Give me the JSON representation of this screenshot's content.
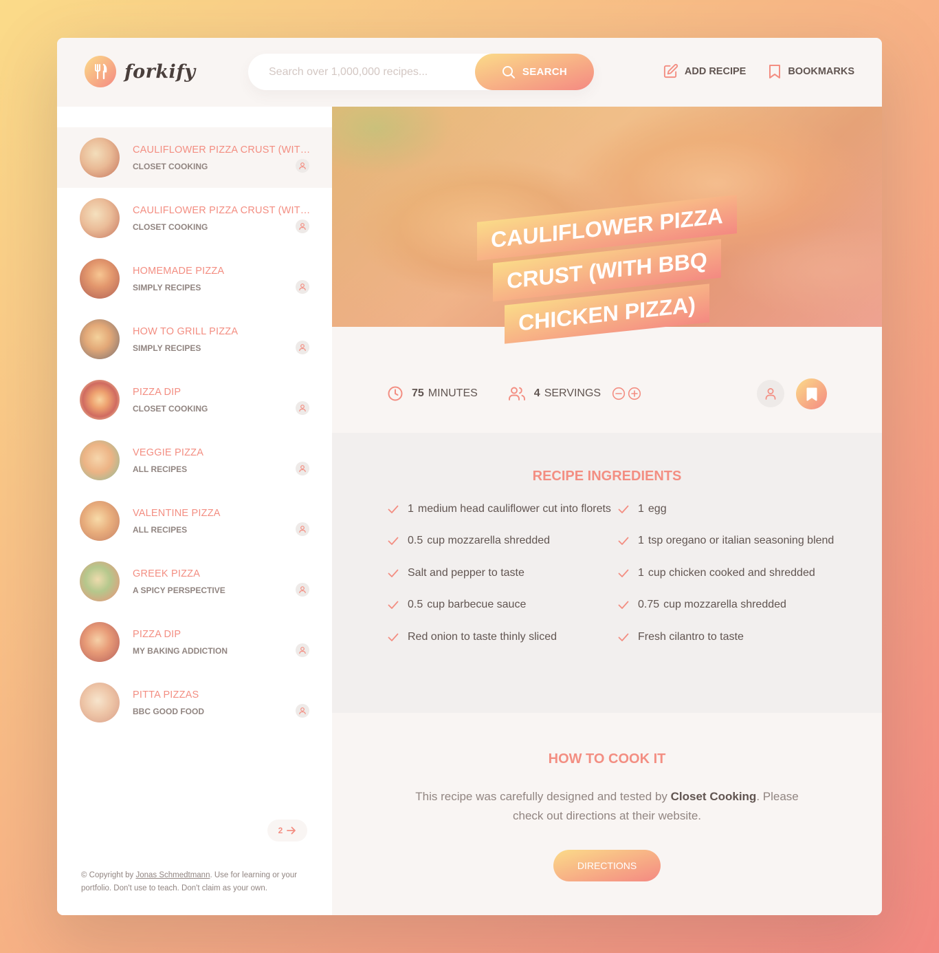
{
  "app": {
    "name": "forkify"
  },
  "search": {
    "placeholder": "Search over 1,000,000 recipes...",
    "button_label": "Search"
  },
  "nav": {
    "add_recipe": "Add recipe",
    "bookmarks": "Bookmarks"
  },
  "results": [
    {
      "title": "CAULIFLOWER PIZZA CRUST (WITH BBQ CHICKEN PIZZA)",
      "publisher": "Closet Cooking",
      "active": true
    },
    {
      "title": "CAULIFLOWER PIZZA CRUST (WITH BBQ CHICKEN PIZZA)",
      "publisher": "Closet Cooking",
      "active": false
    },
    {
      "title": "Homemade Pizza",
      "publisher": "Simply Recipes",
      "active": false
    },
    {
      "title": "How to Grill Pizza",
      "publisher": "Simply Recipes",
      "active": false
    },
    {
      "title": "Pizza Dip",
      "publisher": "Closet Cooking",
      "active": false
    },
    {
      "title": "Veggie Pizza",
      "publisher": "All Recipes",
      "active": false
    },
    {
      "title": "Valentine Pizza",
      "publisher": "All Recipes",
      "active": false
    },
    {
      "title": "Greek Pizza",
      "publisher": "A Spicy Perspective",
      "active": false
    },
    {
      "title": "Pizza Dip",
      "publisher": "My Baking Addiction",
      "active": false
    },
    {
      "title": "Pitta Pizzas",
      "publisher": "BBC Good Food",
      "active": false
    }
  ],
  "pagination": {
    "next_page": "2"
  },
  "copyright": {
    "prefix": "© Copyright by",
    "author": "Jonas Schmedtmann",
    "suffix": ". Use for learning or your portfolio. Don't use to teach. Don't claim as your own."
  },
  "recipe": {
    "title_lines": [
      "Cauliflower Pizza",
      "Crust (with BBQ",
      "Chicken Pizza)"
    ],
    "minutes": "75",
    "minutes_label": "minutes",
    "servings": "4",
    "servings_label": "servings",
    "ingredients_heading": "Recipe ingredients",
    "ingredients": [
      {
        "quantity": "1",
        "description": "medium head cauliflower cut into florets"
      },
      {
        "quantity": "1",
        "description": "egg"
      },
      {
        "quantity": "0.5",
        "description": "cup mozzarella shredded"
      },
      {
        "quantity": "1",
        "description": "tsp oregano or italian seasoning blend"
      },
      {
        "quantity": "",
        "description": "Salt and pepper to taste"
      },
      {
        "quantity": "1",
        "description": "cup chicken cooked and shredded"
      },
      {
        "quantity": "0.5",
        "description": "cup barbecue sauce"
      },
      {
        "quantity": "0.75",
        "description": "cup mozzarella shredded"
      },
      {
        "quantity": "",
        "description": "Red onion to taste thinly sliced"
      },
      {
        "quantity": "",
        "description": "Fresh cilantro to taste"
      }
    ],
    "directions_heading": "How to cook it",
    "directions_text_before": "This recipe was carefully designed and tested by",
    "directions_publisher": "Closet Cooking",
    "directions_text_after": ". Please check out directions at their website.",
    "directions_button": "Directions"
  },
  "colors": {
    "accent_light": "#fbdb89",
    "accent_dark": "#f48982",
    "title": "#f38e82",
    "text": "#615551"
  },
  "icons": [
    "fork-knife-icon",
    "search-icon",
    "edit-icon",
    "bookmark-icon",
    "user-icon",
    "clock-icon",
    "users-icon",
    "minus-circle-icon",
    "plus-circle-icon",
    "check-icon",
    "arrow-right-icon"
  ]
}
